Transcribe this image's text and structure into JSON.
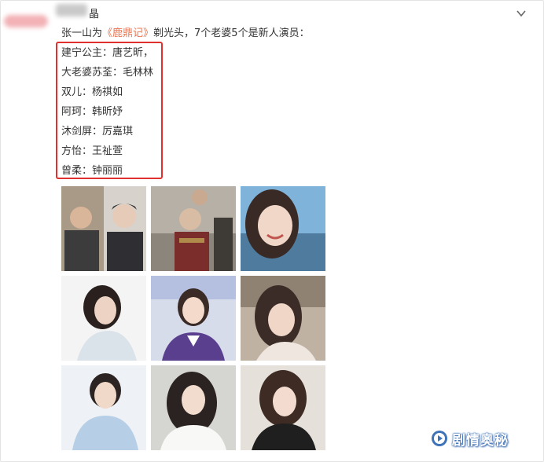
{
  "post": {
    "author_name_visible": "晶",
    "headline_prefix": "张一山为",
    "headline_link": "《鹿鼎记》",
    "headline_suffix": "剃光头，7个老婆5个是新人演员：",
    "cast": [
      "建宁公主：唐艺昕，",
      "大老婆苏荃：毛林林",
      "双儿：杨祺如",
      "阿珂：韩昕妤",
      "沐剑屏：厉嘉琪",
      "方怡：王祉萱",
      "曾柔：钟丽丽"
    ]
  },
  "photos": [
    {
      "subject": "two-men-photo"
    },
    {
      "subject": "shaved-head-man-photo"
    },
    {
      "subject": "smiling-woman-photo"
    },
    {
      "subject": "woman-portrait-photo"
    },
    {
      "subject": "flight-attendant-woman-photo"
    },
    {
      "subject": "woman-selfie-photo"
    },
    {
      "subject": "short-hair-woman-photo"
    },
    {
      "subject": "woman-white-sweater-photo"
    },
    {
      "subject": "woman-black-top-photo"
    }
  ],
  "watermark": {
    "text": "剧情奥秘",
    "icon": "play-circle-icon",
    "color": "#3f73b8"
  },
  "colors": {
    "link": "#eb7350",
    "highlight_box": "#e0312e"
  }
}
